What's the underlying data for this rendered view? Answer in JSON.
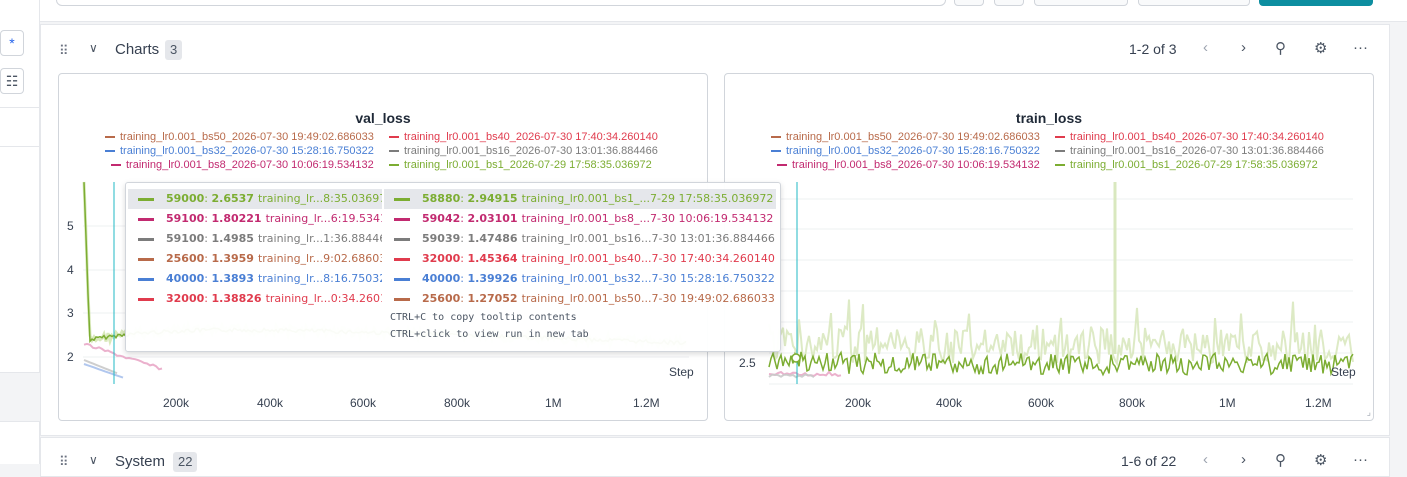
{
  "leftbar": {
    "btn1_icon": "asterisk-icon",
    "btn1_glyph": "*",
    "btn2_icon": "list-icon",
    "btn2_glyph": "☷"
  },
  "charts_section": {
    "title": "Charts",
    "count": "3",
    "pager": "1-2 of 3",
    "icons": [
      "drag-handle-icon",
      "chevron-down-icon",
      "chevron-left-icon",
      "chevron-right-icon",
      "pin-icon",
      "gear-icon",
      "more-icon"
    ]
  },
  "system_section": {
    "title": "System",
    "count": "22",
    "pager": "1-6 of 22"
  },
  "legend": [
    {
      "label": "training_lr0.001_bs50_2026-07-30 19:49:02.686033",
      "color": "#b86a4a"
    },
    {
      "label": "training_lr0.001_bs40_2026-07-30 17:40:34.260140",
      "color": "#e03b4d"
    },
    {
      "label": "training_lr0.001_bs32_2026-07-30 15:28:16.750322",
      "color": "#4a7fd4"
    },
    {
      "label": "training_lr0.001_bs16_2026-07-30 13:01:36.884466",
      "color": "#7c7c7c"
    },
    {
      "label": "training_lr0.001_bs8_2026-07-30 10:06:19.534132",
      "color": "#c22a70"
    },
    {
      "label": "training_lr0.001_bs1_2026-07-29 17:58:35.036972",
      "color": "#7cad32"
    }
  ],
  "charts": [
    {
      "title": "val_loss",
      "x_label": "Step",
      "x_ticks": [
        "200k",
        "400k",
        "600k",
        "800k",
        "1M",
        "1.2M"
      ],
      "y_ticks": [
        "5",
        "4",
        "3",
        "2"
      ],
      "chart_data": {
        "type": "line",
        "xlim": [
          0,
          1300000
        ],
        "ylim": [
          1.6,
          5.9
        ]
      }
    },
    {
      "title": "train_loss",
      "x_label": "Step",
      "x_ticks": [
        "200k",
        "400k",
        "600k",
        "800k",
        "1M",
        "1.2M"
      ],
      "y_ticks": [
        "2.5"
      ],
      "chart_data": {
        "type": "line",
        "xlim": [
          0,
          1300000
        ]
      }
    }
  ],
  "tooltip": {
    "left": [
      {
        "step": "59000",
        "value": "2.6537",
        "run": "training_lr...8:35.03697",
        "color": "#7cad32"
      },
      {
        "step": "59100",
        "value": "1.80221",
        "run": "training_lr...6:19.53413",
        "color": "#c22a70"
      },
      {
        "step": "59100",
        "value": "1.4985",
        "run": "training_lr...1:36.88446",
        "color": "#7c7c7c"
      },
      {
        "step": "25600",
        "value": "1.3959",
        "run": "training_lr...9:02.68603",
        "color": "#b86a4a"
      },
      {
        "step": "40000",
        "value": "1.3893",
        "run": "training_lr...8:16.75032",
        "color": "#4a7fd4"
      },
      {
        "step": "32000",
        "value": "1.38826",
        "run": "training_lr...0:34.26014",
        "color": "#e03b4d"
      }
    ],
    "right": [
      {
        "step": "58880",
        "value": "2.94915",
        "run": "training_lr0.001_bs1_...7-29 17:58:35.036972",
        "color": "#7cad32"
      },
      {
        "step": "59042",
        "value": "2.03101",
        "run": "training_lr0.001_bs8_...7-30 10:06:19.534132",
        "color": "#c22a70"
      },
      {
        "step": "59039",
        "value": "1.47486",
        "run": "training_lr0.001_bs16...7-30 13:01:36.884466",
        "color": "#7c7c7c"
      },
      {
        "step": "32000",
        "value": "1.45364",
        "run": "training_lr0.001_bs40...7-30 17:40:34.260140",
        "color": "#e03b4d"
      },
      {
        "step": "40000",
        "value": "1.39926",
        "run": "training_lr0.001_bs32...7-30 15:28:16.750322",
        "color": "#4a7fd4"
      },
      {
        "step": "25600",
        "value": "1.27052",
        "run": "training_lr0.001_bs50...7-30 19:49:02.686033",
        "color": "#b86a4a"
      }
    ],
    "hint1": "CTRL+C to copy tooltip contents",
    "hint2": "CTRL+click to view run in new tab"
  }
}
